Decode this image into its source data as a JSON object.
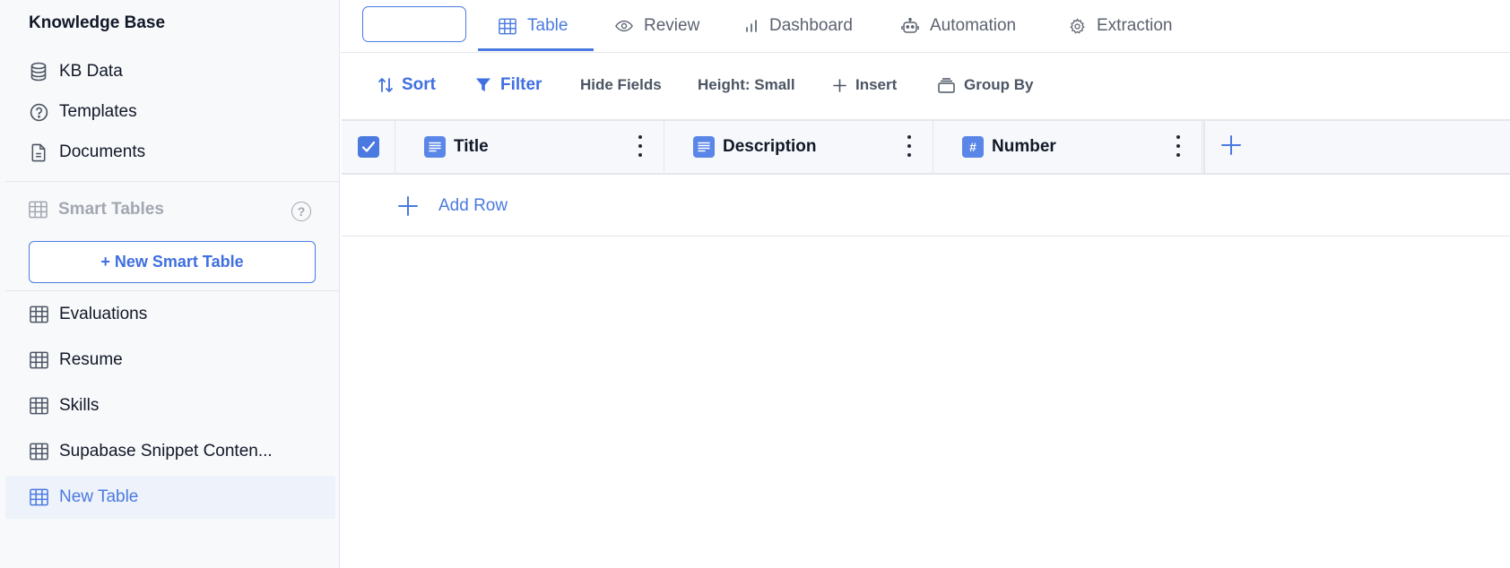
{
  "sidebar": {
    "title": "Knowledge Base",
    "top_items": [
      {
        "label": "KB Data",
        "icon": "database-icon"
      },
      {
        "label": "Templates",
        "icon": "question-circle-icon"
      },
      {
        "label": "Documents",
        "icon": "document-icon"
      }
    ],
    "section_title": "Smart Tables",
    "new_button": "+ New Smart Table",
    "tables": [
      {
        "label": "Evaluations"
      },
      {
        "label": "Resume"
      },
      {
        "label": "Skills"
      },
      {
        "label": "Supabase Snippet Conten..."
      },
      {
        "label": "New Table",
        "active": true
      }
    ]
  },
  "header": {
    "name_input_value": "",
    "tabs": [
      {
        "label": "Table",
        "icon": "table-icon",
        "active": true
      },
      {
        "label": "Review",
        "icon": "eye-icon"
      },
      {
        "label": "Dashboard",
        "icon": "bar-chart-icon"
      },
      {
        "label": "Automation",
        "icon": "robot-icon"
      },
      {
        "label": "Extraction",
        "icon": "gear-icon"
      }
    ]
  },
  "toolbar": {
    "sort": "Sort",
    "filter": "Filter",
    "hide_fields": "Hide Fields",
    "height": "Height: Small",
    "insert": "Insert",
    "group_by": "Group By"
  },
  "grid": {
    "columns": [
      {
        "label": "Title",
        "type": "text"
      },
      {
        "label": "Description",
        "type": "text"
      },
      {
        "label": "Number",
        "type": "number",
        "type_glyph": "#"
      }
    ],
    "add_row": "Add Row"
  },
  "colors": {
    "accent": "#4a7ae0",
    "sidebar_bg": "#f8f9fb",
    "muted": "#a2a7b0"
  }
}
